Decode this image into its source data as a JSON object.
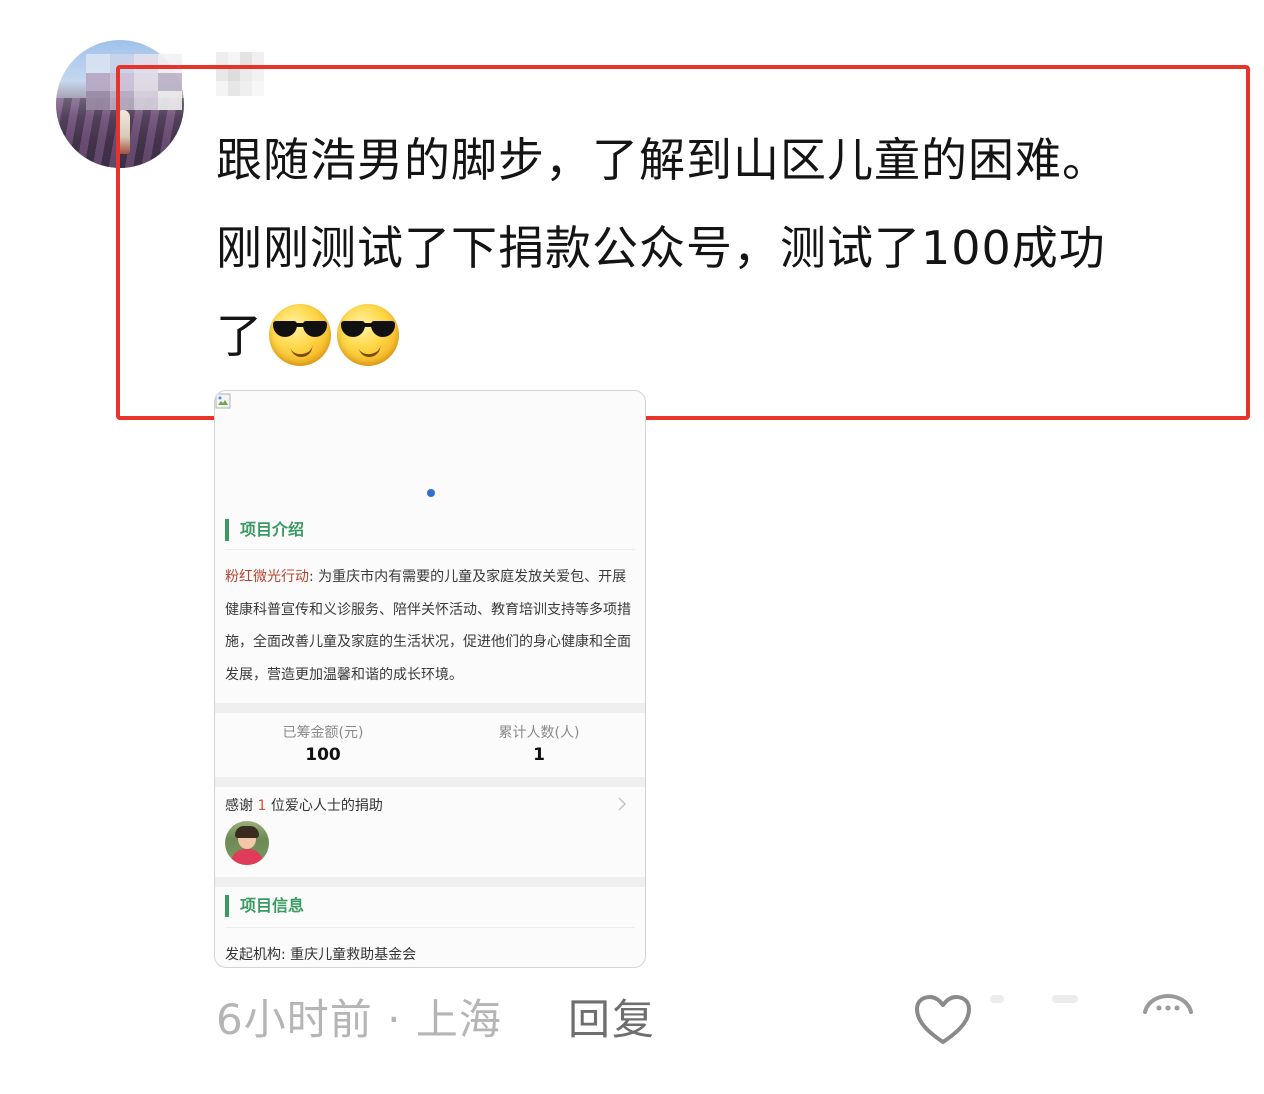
{
  "comment": {
    "line1": "跟随浩男的脚步，了解到山区儿童的困难。",
    "line2": "刚刚测试了下捐款公众号，测试了100成功",
    "line3": "了",
    "emojis": [
      "sunglasses-smiley",
      "sunglasses-smiley"
    ]
  },
  "card": {
    "intro_title": "项目介绍",
    "intro_name": "粉红微光行动",
    "intro_body": ": 为重庆市内有需要的儿童及家庭发放关爱包、开展健康科普宣传和义诊服务、陪伴关怀活动、教育培训支持等多项措施，全面改善儿童及家庭的生活状况，促进他们的身心健康和全面发展，营造更加温馨和谐的成长环境。",
    "stats": [
      {
        "label": "已筹金额(元)",
        "value": "100"
      },
      {
        "label": "累计人数(人)",
        "value": "1"
      }
    ],
    "donors_prefix": "感谢",
    "donors_count": "1",
    "donors_suffix": "位爱心人士的捐助",
    "info_title": "项目信息",
    "org_label": "发起机构:",
    "org_value": "重庆儿童救助基金会"
  },
  "footer": {
    "time": "6小时前",
    "separator": "·",
    "location": "上海",
    "reply_label": "回复"
  },
  "colors": {
    "highlight_frame": "#e8332a",
    "section_accent": "#3b9a63",
    "project_name": "#b8442e",
    "donor_count": "#e24b3b",
    "carousel_dot": "#2f6fd0"
  }
}
